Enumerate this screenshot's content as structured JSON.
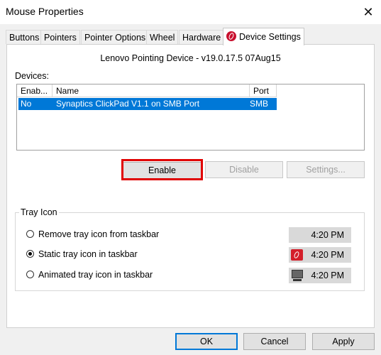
{
  "window": {
    "title": "Mouse Properties",
    "close_glyph": "✕"
  },
  "tabs": [
    {
      "label": "Buttons"
    },
    {
      "label": "Pointers"
    },
    {
      "label": "Pointer Options"
    },
    {
      "label": "Wheel"
    },
    {
      "label": "Hardware"
    },
    {
      "label": "Device Settings",
      "active": true,
      "icon": "lenovo-logo-icon"
    }
  ],
  "device_settings": {
    "heading": "Lenovo Pointing Device - v19.0.17.5 07Aug15",
    "devices_label": "Devices:",
    "columns": [
      "Enab...",
      "Name",
      "Port"
    ],
    "rows": [
      {
        "enabled": "No",
        "name": "Synaptics ClickPad V1.1 on SMB Port",
        "port": "SMB",
        "selected": true
      }
    ],
    "buttons": {
      "enable": "Enable",
      "disable": "Disable",
      "settings": "Settings..."
    }
  },
  "tray_icon": {
    "label": "Tray Icon",
    "options": [
      {
        "label": "Remove tray icon from taskbar",
        "checked": false,
        "preview_time": "4:20 PM",
        "preview_icon": "none"
      },
      {
        "label": "Static tray icon in taskbar",
        "checked": true,
        "preview_time": "4:20 PM",
        "preview_icon": "lenovo-tray-icon"
      },
      {
        "label": "Animated tray icon in taskbar",
        "checked": false,
        "preview_time": "4:20 PM",
        "preview_icon": "monitor-tray-icon"
      }
    ]
  },
  "dialog_buttons": {
    "ok": "OK",
    "cancel": "Cancel",
    "apply": "Apply"
  },
  "colors": {
    "selection": "#0078d7",
    "highlight": "#e00000",
    "brand": "#c8102e"
  }
}
